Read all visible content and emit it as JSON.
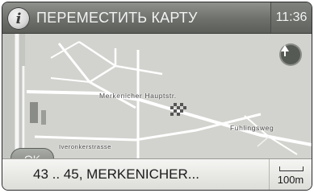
{
  "header": {
    "info_icon_glyph": "i",
    "title": "ПЕРЕМЕСТИТЬ КАРТУ",
    "time": "11:36"
  },
  "map": {
    "street_labels": {
      "main": "Merkenicher Hauptstr.",
      "east": "Fuhlingsweg",
      "lower": "Iveronkerstrasse"
    },
    "compass_icon": "compass-arrow-icon",
    "ok_label": "OK"
  },
  "footer": {
    "location": "43 .. 45, MERKENICHER...",
    "scale": "100m"
  },
  "colors": {
    "titlebar": "#6d706b",
    "map_bg": "#cfd0cb",
    "road": "#ffffff",
    "bottombar": "#eeeeec"
  }
}
